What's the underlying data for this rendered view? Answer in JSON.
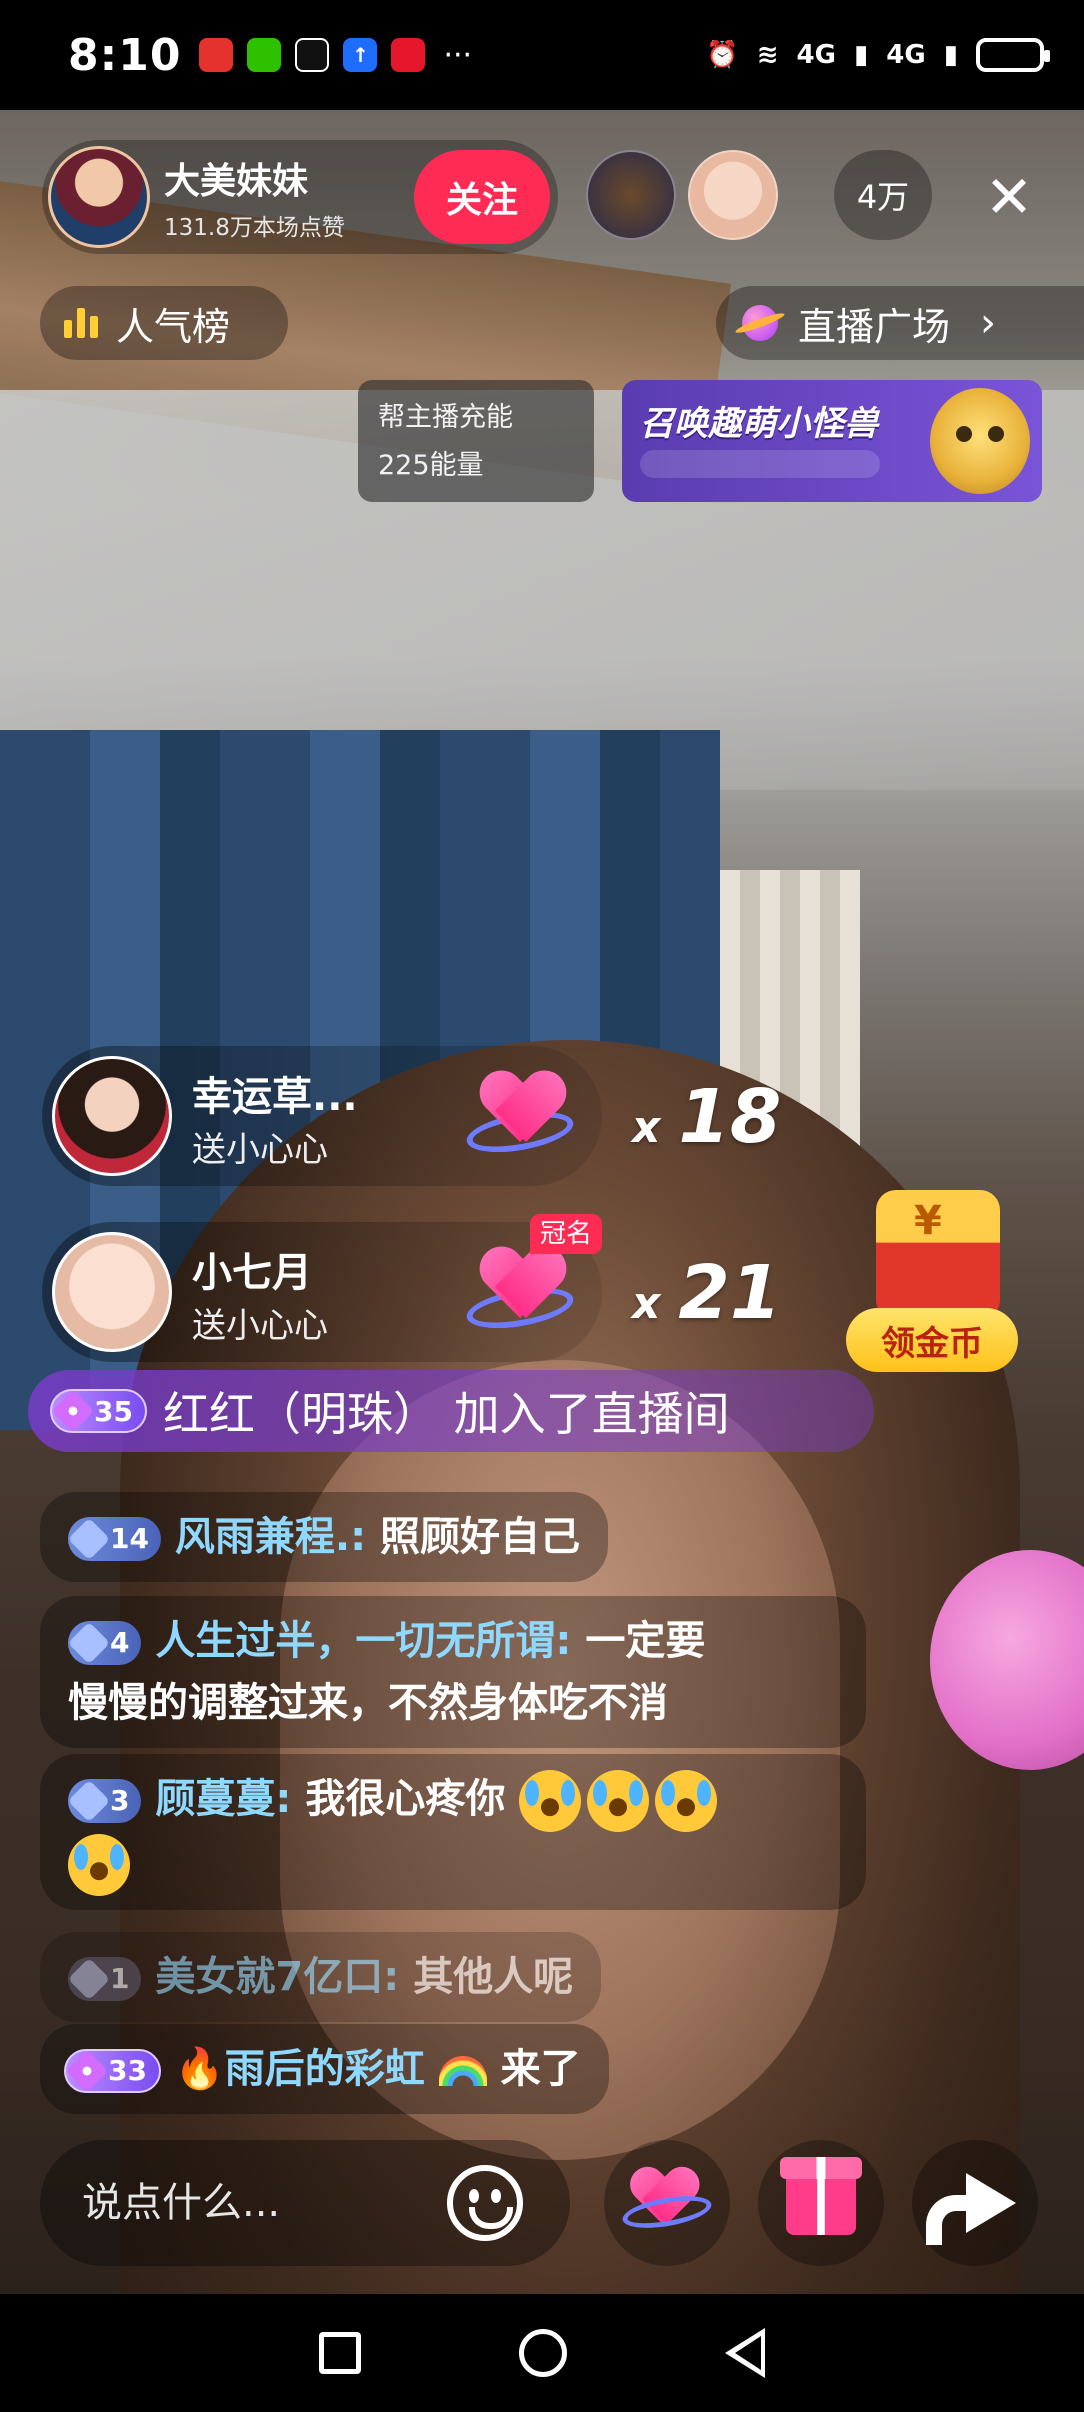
{
  "status_bar": {
    "time": "8:10",
    "notification_icons": [
      "huawei-app-icon",
      "wechat-icon",
      "douyin-icon",
      "upload-app-icon",
      "weibo-icon"
    ],
    "more": "···",
    "signal_labels": [
      "4G",
      "4G"
    ],
    "battery_level": 0.7
  },
  "host": {
    "name": "大美妹妹",
    "likes": "131.8万本场点赞",
    "follow_label": "关注"
  },
  "viewers": {
    "count": "4万"
  },
  "top_nav": {
    "rank_label": "人气榜",
    "plaza_label": "直播广场"
  },
  "energy": {
    "line1": "帮主播充能",
    "line2": "225能量"
  },
  "summon_banner": {
    "title": "召唤趣萌小怪兽"
  },
  "gifts": [
    {
      "name": "幸运草...",
      "action": "送小心心",
      "count": "18"
    },
    {
      "name": "小七月",
      "action": "送小心心",
      "count": "21",
      "badge": "冠名"
    }
  ],
  "coin_widget": {
    "label": "领金币"
  },
  "join_banner": {
    "level": "35",
    "text": "红红（明珠） 加入了直播间"
  },
  "chat": [
    {
      "level": "14",
      "user": "风雨兼程.",
      "text": "照顾好自己"
    },
    {
      "level": "4",
      "user": "人生过半，一切无所谓",
      "text": "一定要",
      "text2": "慢慢的调整过来，不然身体吃不消"
    },
    {
      "level": "3",
      "user": "顾蔓蔓",
      "text": "我很心疼你"
    },
    {
      "level": "1",
      "user": "美女就7亿口",
      "text": "其他人呢"
    },
    {
      "level": "33",
      "user": "雨后的彩虹",
      "text": "来了"
    }
  ],
  "bottom_bar": {
    "input_placeholder": "说点什么..."
  },
  "colors": {
    "accent": "#fe2c55",
    "chat_user": "#8fd8ff",
    "join_banner": "#7a3cc8"
  }
}
